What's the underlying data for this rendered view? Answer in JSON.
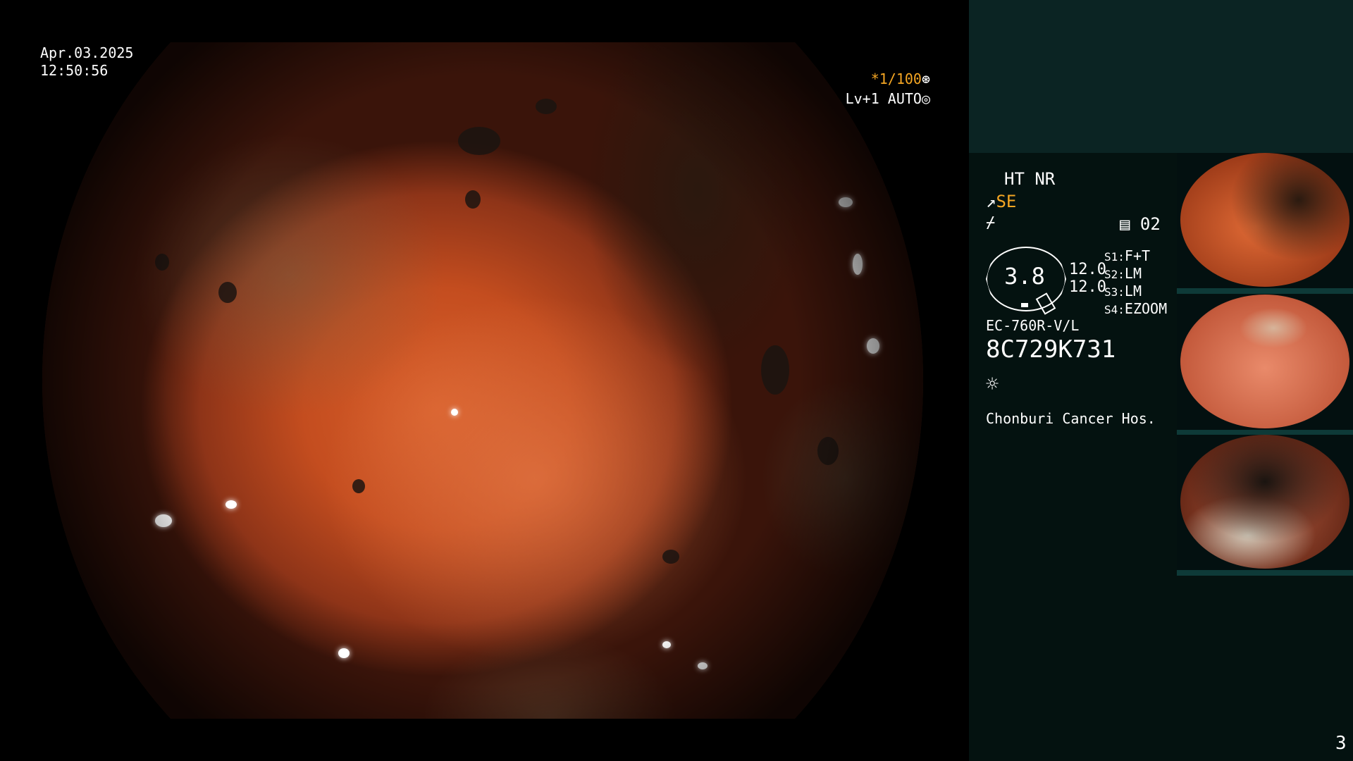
{
  "overlay": {
    "date": "Apr.03.2025",
    "time": "12:50:56",
    "shutter": "*1/100",
    "level": "Lv+1 AUTO"
  },
  "panel": {
    "ht_nr": "HT NR",
    "se": "SE",
    "preset": "02",
    "gauge_value": "3.8",
    "enhance_1": "12.0",
    "enhance_2": "12.0",
    "switches": [
      {
        "key": "S1",
        "value": "F+T"
      },
      {
        "key": "S2",
        "value": "LM"
      },
      {
        "key": "S3",
        "value": "LM"
      },
      {
        "key": "S4",
        "value": "EZOOM"
      }
    ],
    "scope_model": "EC-760R-V/L",
    "scope_serial": "8C729K731",
    "hospital": "Chonburi Cancer Hos."
  },
  "page_number": "3",
  "icons": {
    "aperture": "aperture-icon",
    "light": "sun-icon"
  }
}
